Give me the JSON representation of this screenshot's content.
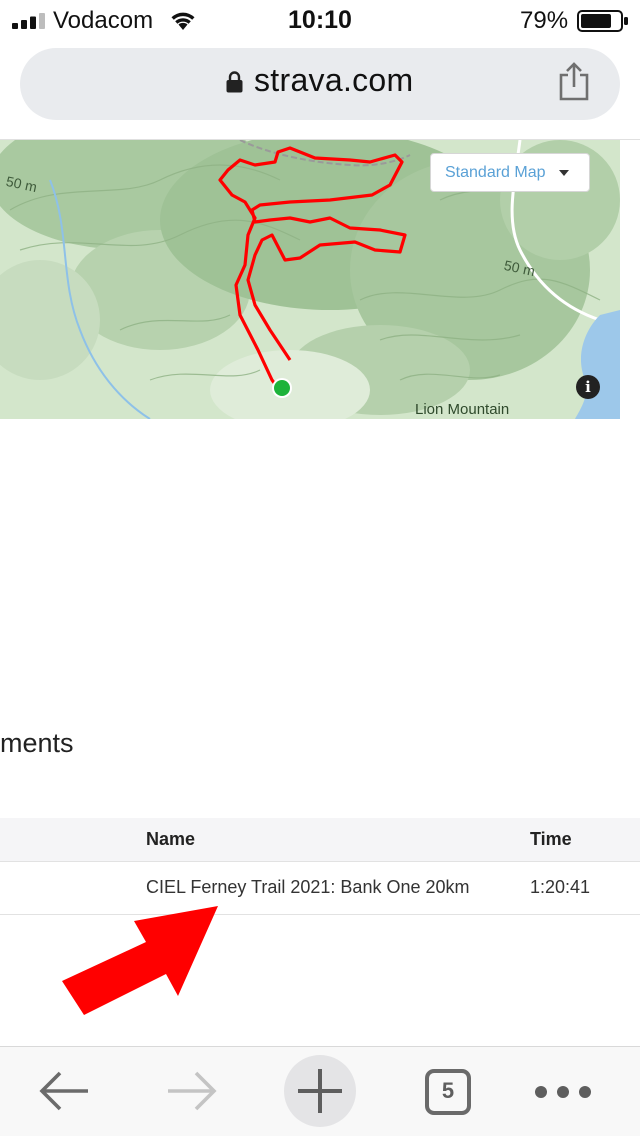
{
  "status_bar": {
    "carrier": "Vodacom",
    "time": "10:10",
    "battery_percent": "79%",
    "battery_level": 0.79,
    "signal_bars_filled": 3,
    "signal_bars_total": 4
  },
  "browser": {
    "url": "strava.com",
    "lock_icon": "lock-icon",
    "share_icon": "share-icon"
  },
  "map": {
    "map_type": "Standard Map",
    "place_label": "Lion Mountain",
    "contour_label_left": "50 m",
    "contour_label_right": "50 m",
    "info_glyph": "i",
    "route_color": "#ff0000",
    "start_marker_color": "#1db33a"
  },
  "segments": {
    "heading": "ments",
    "columns": {
      "name": "Name",
      "time": "Time"
    },
    "rows": [
      {
        "name": "CIEL Ferney Trail 2021: Bank One 20km",
        "time": "1:20:41"
      }
    ]
  },
  "annotation": {
    "arrow_color": "#ff0000"
  },
  "toolbar": {
    "tab_count": "5",
    "icons": [
      "back-arrow-icon",
      "forward-arrow-icon",
      "plus-icon",
      "tabs-icon",
      "more-icon"
    ]
  }
}
